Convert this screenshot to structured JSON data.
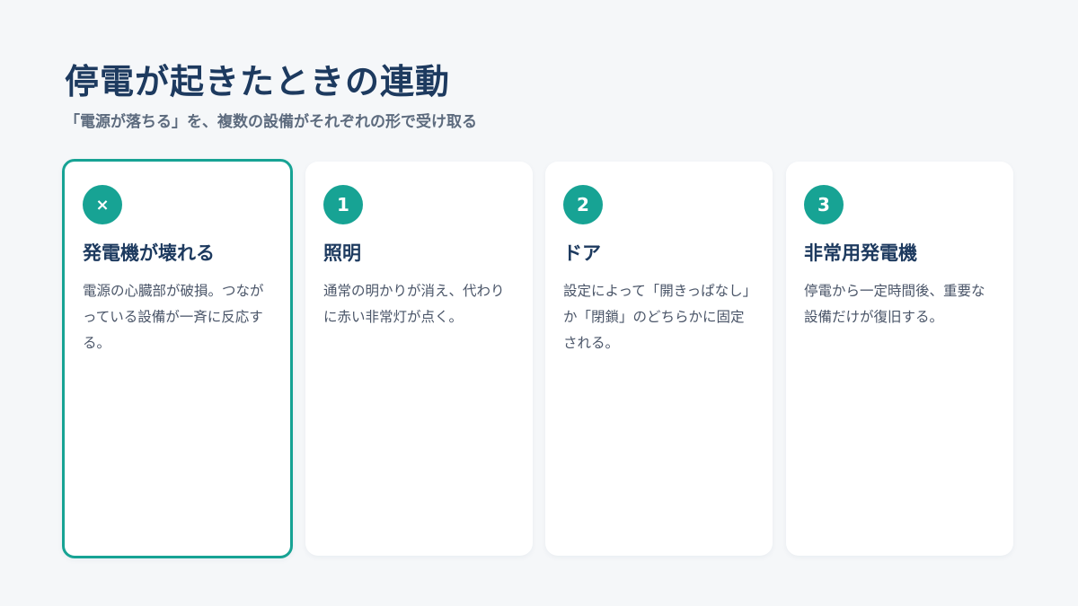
{
  "header": {
    "title": "停電が起きたときの連動",
    "subtitle": "「電源が落ちる」を、複数の設備がそれぞれの形で受け取る"
  },
  "accent_color": "#17a394",
  "cards": [
    {
      "badge": "×",
      "badge_icon": "close-icon",
      "title": "発電機が壊れる",
      "body": "電源の心臓部が破損。つながっている設備が一斉に反応する。",
      "highlighted": true
    },
    {
      "badge": "1",
      "title": "照明",
      "body": "通常の明かりが消え、代わりに赤い非常灯が点く。",
      "highlighted": false
    },
    {
      "badge": "2",
      "title": "ドア",
      "body": "設定によって「開きっぱなし」か「閉鎖」のどちらかに固定される。",
      "highlighted": false
    },
    {
      "badge": "3",
      "title": "非常用発電機",
      "body": "停電から一定時間後、重要な設備だけが復旧する。",
      "highlighted": false
    }
  ]
}
